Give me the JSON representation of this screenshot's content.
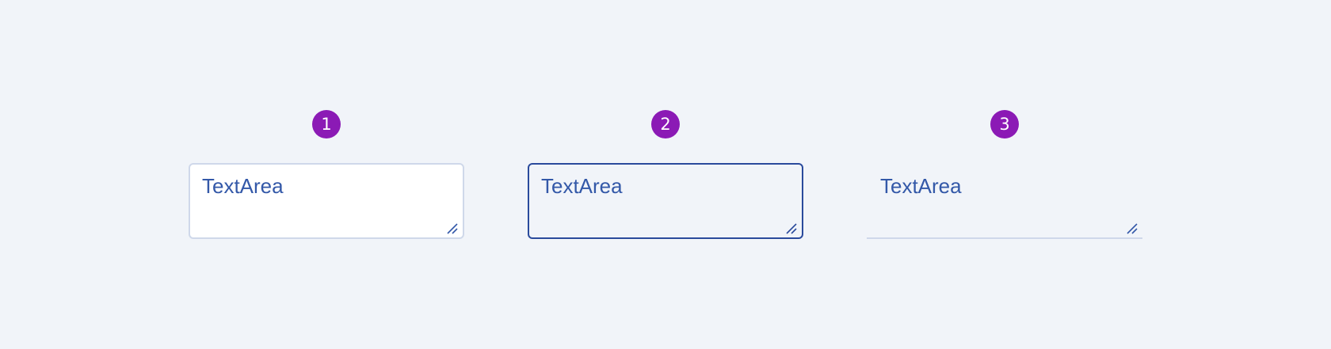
{
  "variants": [
    {
      "badge": "1",
      "value": "TextArea",
      "state": "default"
    },
    {
      "badge": "2",
      "value": "TextArea",
      "state": "focused"
    },
    {
      "badge": "3",
      "value": "TextArea",
      "state": "underline"
    }
  ],
  "colors": {
    "background": "#f1f4f9",
    "badge": "#8b1ab5",
    "text": "#3358a8",
    "border_default": "#cfd8ea",
    "border_focused": "#2a4a9c"
  },
  "icons": {
    "resize": "resize-handle-icon"
  }
}
